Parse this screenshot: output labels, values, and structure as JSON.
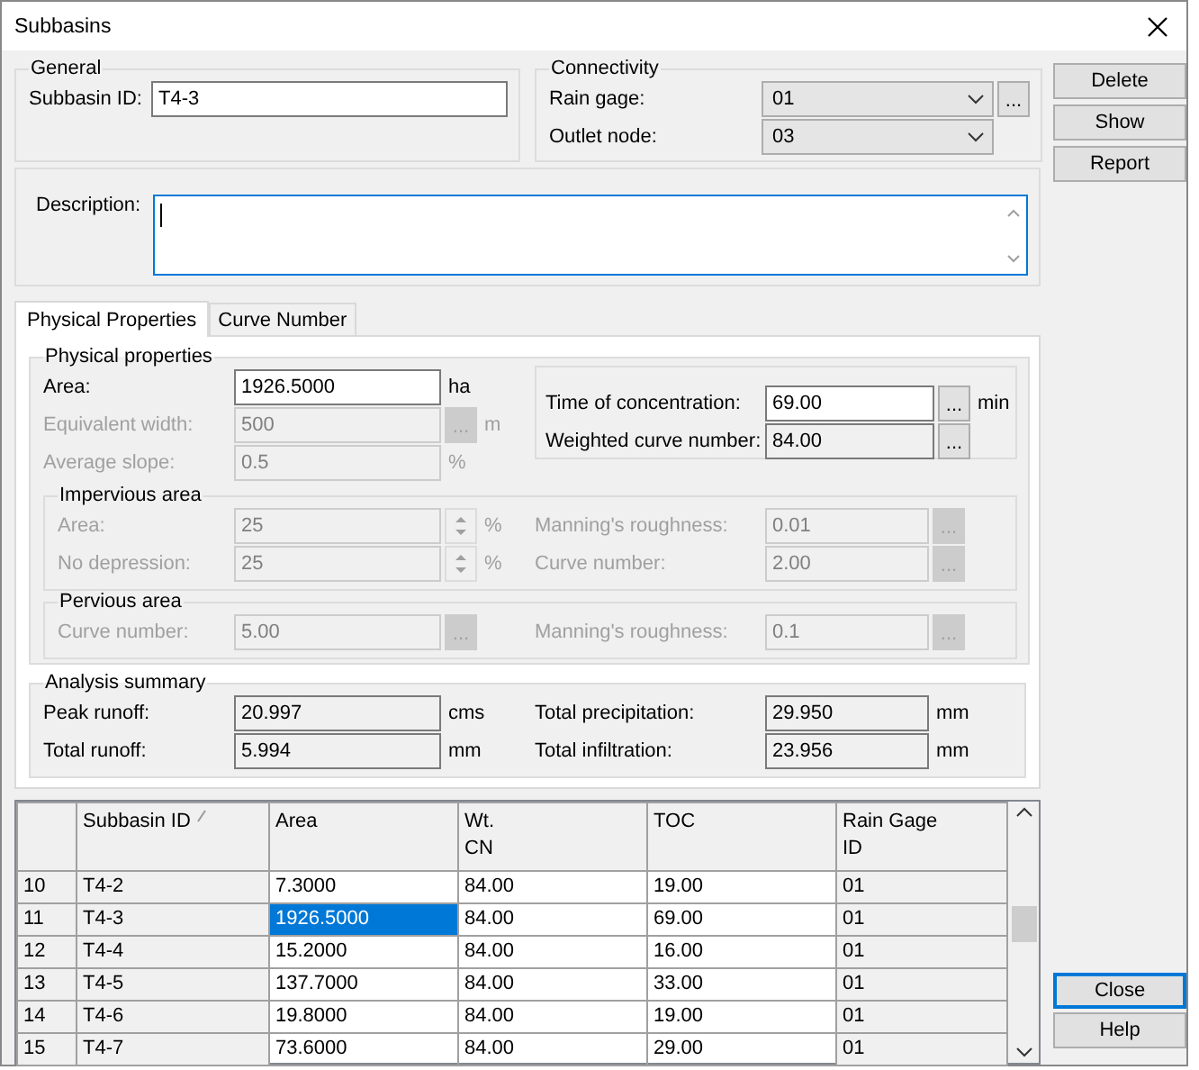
{
  "window": {
    "title": "Subbasins"
  },
  "general": {
    "title": "General",
    "fields": [
      {
        "label": "Subbasin ID:",
        "value": "T4-3"
      }
    ]
  },
  "connectivity": {
    "title": "Connectivity",
    "fields": [
      {
        "label": "Rain gage:",
        "value": "01",
        "button": "..."
      },
      {
        "label": "Outlet node:",
        "value": "03"
      }
    ]
  },
  "description": {
    "label": "Description:"
  },
  "actions": [
    {
      "label": "Delete",
      "default": false
    },
    {
      "label": "Show",
      "default": false
    },
    {
      "label": "Report",
      "default": false
    }
  ],
  "footer_actions": [
    {
      "label": "Close",
      "default": true
    },
    {
      "label": "Help",
      "default": false
    }
  ],
  "tabs": [
    {
      "label": "Physical Properties",
      "selected": true
    },
    {
      "label": "Curve Number",
      "selected": false
    }
  ],
  "physical": {
    "title": "Physical properties",
    "left": [
      {
        "label": "Area:",
        "value": "1926.5000",
        "unit": "ha",
        "disabled": false,
        "read_only": false
      },
      {
        "label": "Equivalent width:",
        "value": "500",
        "button": "...",
        "unit": "m",
        "disabled": true,
        "read_only": false
      },
      {
        "label": "Average slope:",
        "value": "0.5",
        "unit": "%",
        "disabled": true,
        "read_only": false
      }
    ],
    "right": [
      {
        "label": "Time of concentration:",
        "value": "69.00",
        "button": "...",
        "unit": "min",
        "disabled": false,
        "read_only": false
      },
      {
        "label": "Weighted curve number:",
        "value": "84.00",
        "button": "...",
        "disabled": false,
        "read_only": true
      }
    ],
    "impervious": {
      "title": "Impervious area",
      "rows": [
        {
          "left": {
            "label": "Area:",
            "value": "25",
            "spinner": true,
            "unit": "%",
            "disabled": true,
            "read_only": false
          },
          "right": {
            "label": "Manning's roughness:",
            "value": "0.01",
            "button": "...",
            "disabled": true,
            "read_only": false
          }
        },
        {
          "left": {
            "label": "No depression:",
            "value": "25",
            "spinner": true,
            "unit": "%",
            "disabled": true,
            "read_only": false
          },
          "right": {
            "label": "Curve number:",
            "value": "2.00",
            "button": "...",
            "disabled": true,
            "read_only": false
          }
        }
      ]
    },
    "pervious": {
      "title": "Pervious area",
      "rows": [
        {
          "left": {
            "label": "Curve number:",
            "value": "5.00",
            "button": "...",
            "disabled": true,
            "read_only": false
          },
          "right": {
            "label": "Manning's roughness:",
            "value": "0.1",
            "button": "...",
            "disabled": true,
            "read_only": false
          }
        }
      ]
    }
  },
  "analysis": {
    "title": "Analysis summary",
    "rows": [
      {
        "left": {
          "label": "Peak runoff:",
          "value": "20.997",
          "unit": "cms",
          "disabled": false,
          "read_only": true
        },
        "right": {
          "label": "Total precipitation:",
          "value": "29.950",
          "unit": "mm",
          "disabled": false,
          "read_only": true
        }
      },
      {
        "left": {
          "label": "Total runoff:",
          "value": "5.994",
          "unit": "mm",
          "disabled": false,
          "read_only": true
        },
        "right": {
          "label": "Total infiltration:",
          "value": "23.956",
          "unit": "mm",
          "disabled": false,
          "read_only": true
        }
      }
    ]
  },
  "table": {
    "columns": [
      {
        "label": "Subbasin ID",
        "sorted": true,
        "read_only": true
      },
      {
        "label": "Area",
        "sorted": false,
        "read_only": false
      },
      {
        "label": "Wt.\nCN",
        "sorted": false,
        "read_only": false
      },
      {
        "label": "TOC",
        "sorted": false,
        "read_only": false
      },
      {
        "label": "Rain Gage\nID",
        "sorted": false,
        "read_only": true
      }
    ],
    "rows": [
      {
        "number": "10",
        "cells": [
          {
            "text": "T4-2",
            "selected": false
          },
          {
            "text": "7.3000",
            "selected": false
          },
          {
            "text": "84.00",
            "selected": false
          },
          {
            "text": "19.00",
            "selected": false
          },
          {
            "text": "01",
            "selected": false
          }
        ]
      },
      {
        "number": "11",
        "cells": [
          {
            "text": "T4-3",
            "selected": false
          },
          {
            "text": "1926.5000",
            "selected": true
          },
          {
            "text": "84.00",
            "selected": false
          },
          {
            "text": "69.00",
            "selected": false
          },
          {
            "text": "01",
            "selected": false
          }
        ]
      },
      {
        "number": "12",
        "cells": [
          {
            "text": "T4-4",
            "selected": false
          },
          {
            "text": "15.2000",
            "selected": false
          },
          {
            "text": "84.00",
            "selected": false
          },
          {
            "text": "16.00",
            "selected": false
          },
          {
            "text": "01",
            "selected": false
          }
        ]
      },
      {
        "number": "13",
        "cells": [
          {
            "text": "T4-5",
            "selected": false
          },
          {
            "text": "137.7000",
            "selected": false
          },
          {
            "text": "84.00",
            "selected": false
          },
          {
            "text": "33.00",
            "selected": false
          },
          {
            "text": "01",
            "selected": false
          }
        ]
      },
      {
        "number": "14",
        "cells": [
          {
            "text": "T4-6",
            "selected": false
          },
          {
            "text": "19.8000",
            "selected": false
          },
          {
            "text": "84.00",
            "selected": false
          },
          {
            "text": "19.00",
            "selected": false
          },
          {
            "text": "01",
            "selected": false
          }
        ]
      },
      {
        "number": "15",
        "cells": [
          {
            "text": "T4-7",
            "selected": false
          },
          {
            "text": "73.6000",
            "selected": false
          },
          {
            "text": "84.00",
            "selected": false
          },
          {
            "text": "29.00",
            "selected": false
          },
          {
            "text": "01",
            "selected": false
          }
        ]
      }
    ]
  }
}
